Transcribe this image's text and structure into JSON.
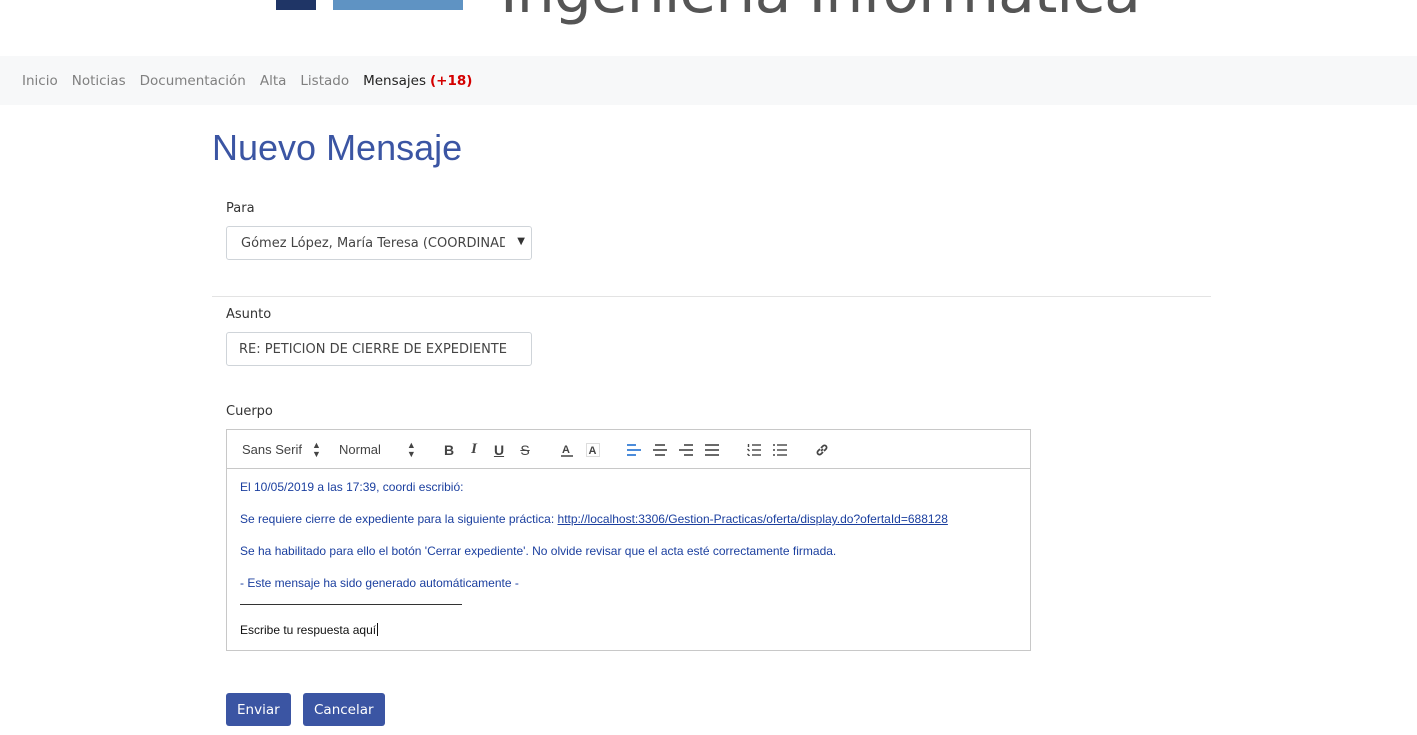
{
  "header": {
    "logo_text": "Ingeniería Informática"
  },
  "nav": {
    "items": [
      {
        "label": "Inicio"
      },
      {
        "label": "Noticias"
      },
      {
        "label": "Documentación"
      },
      {
        "label": "Alta"
      },
      {
        "label": "Listado"
      }
    ],
    "active": {
      "label": "Mensajes",
      "badge": "(+18)"
    }
  },
  "page": {
    "title": "Nuevo Mensaje"
  },
  "form": {
    "to_label": "Para",
    "to_value": "Gómez López, María Teresa (COORDINADOR)",
    "subject_label": "Asunto",
    "subject_value": "RE: PETICIÓN DE CIERRE DE EXPEDIENTE",
    "body_label": "Cuerpo"
  },
  "editor": {
    "toolbar": {
      "font": "Sans Serif",
      "size": "Normal",
      "icons": [
        "bold-icon",
        "italic-icon",
        "underline-icon",
        "strike-icon",
        "text-color-icon",
        "background-color-icon",
        "align-left-icon",
        "align-center-icon",
        "align-right-icon",
        "align-justify-icon",
        "ordered-list-icon",
        "bullet-list-icon",
        "link-icon"
      ]
    },
    "quote_header": "El 10/05/2019 a las 17:39, coordi escribió:",
    "line1_prefix": "Se requiere cierre de expediente para la siguiente práctica: ",
    "line1_link": "http://localhost:3306/Gestion-Practicas/oferta/display.do?ofertaId=688128",
    "line2": " Se ha habilitado para ello el botón 'Cerrar expediente'. No olvide revisar que el acta esté correctamente firmada.",
    "line3": " - Este mensaje ha sido generado automáticamente -",
    "reply_text": "Escribe tu respuesta aquí"
  },
  "buttons": {
    "send": "Enviar",
    "cancel": "Cancelar"
  },
  "colors": {
    "brand_blue": "#3b55a3",
    "badge_red": "#d40000",
    "quote_text": "#1b3f9f"
  }
}
